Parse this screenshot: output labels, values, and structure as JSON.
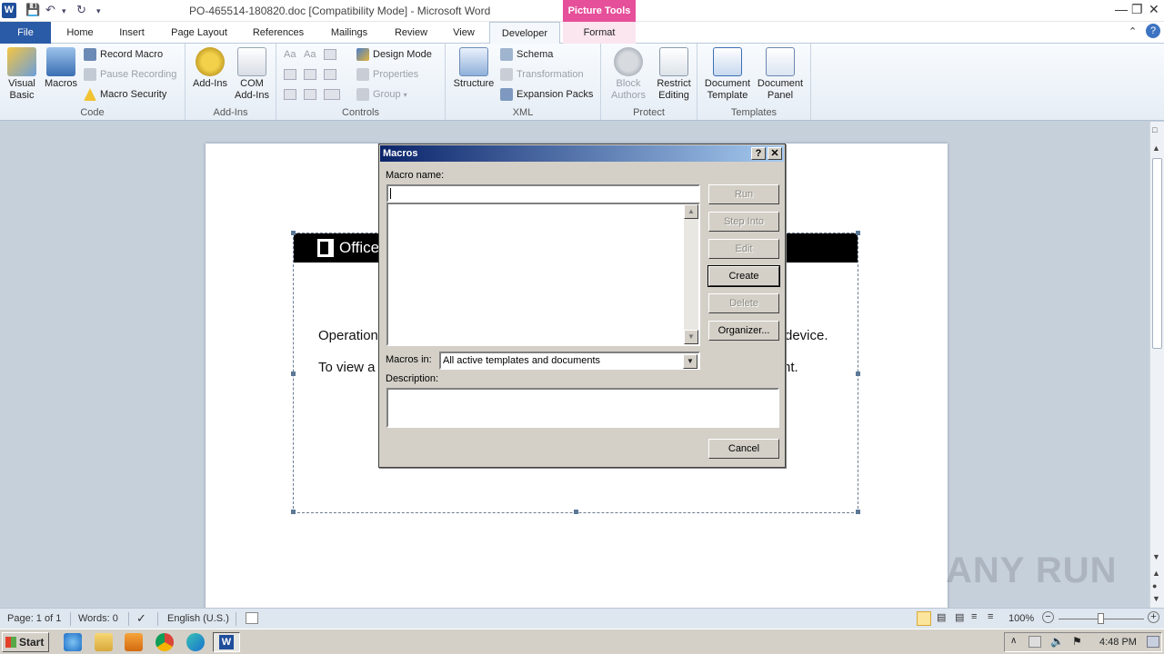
{
  "window": {
    "title": "PO-465514-180820.doc [Compatibility Mode]  -  Microsoft Word",
    "context_tab_title": "Picture Tools",
    "app_icon_letter": "W"
  },
  "tabs": [
    "File",
    "Home",
    "Insert",
    "Page Layout",
    "References",
    "Mailings",
    "Review",
    "View",
    "Developer",
    "Format"
  ],
  "active_tab": "Developer",
  "ribbon": {
    "code": {
      "label": "Code",
      "visual_basic": "Visual Basic",
      "macros": "Macros",
      "record_macro": "Record Macro",
      "pause_recording": "Pause Recording",
      "macro_security": "Macro Security"
    },
    "addins": {
      "label": "Add-Ins",
      "addins": "Add-Ins",
      "com_addins": "COM Add-Ins"
    },
    "controls": {
      "label": "Controls",
      "design_mode": "Design Mode",
      "properties": "Properties",
      "group": "Group"
    },
    "xml": {
      "label": "XML",
      "structure": "Structure",
      "schema": "Schema",
      "transformation": "Transformation",
      "expansion_packs": "Expansion Packs"
    },
    "protect": {
      "label": "Protect",
      "block_authors": "Block Authors",
      "restrict_editing": "Restrict Editing"
    },
    "templates": {
      "label": "Templates",
      "document_template": "Document Template",
      "document_panel": "Document Panel"
    }
  },
  "document": {
    "banner_text": "Office",
    "line1_left": "Operation",
    "line1_right": "device.",
    "line2_left": "To view a",
    "line2_right": "nt."
  },
  "dialog": {
    "title": "Macros",
    "help_btn": "?",
    "close_btn": "✕",
    "macro_name_label": "Macro name:",
    "macro_name_value": "",
    "macros_in_label": "Macros in:",
    "macros_in_value": "All active templates and documents",
    "description_label": "Description:",
    "buttons": {
      "run": "Run",
      "step_into": "Step Into",
      "edit": "Edit",
      "create": "Create",
      "delete": "Delete",
      "organizer": "Organizer...",
      "cancel": "Cancel"
    }
  },
  "statusbar": {
    "page": "Page: 1 of 1",
    "words": "Words: 0",
    "language": "English (U.S.)",
    "zoom": "100%"
  },
  "taskbar": {
    "start": "Start",
    "clock": "4:48 PM"
  },
  "watermark": "ANY RUN",
  "colors": {
    "file_tab": "#2a5ba6",
    "picture_tools": "#e64f9a",
    "dialog_title_start": "#0a246a",
    "dialog_title_end": "#a6caf0"
  }
}
